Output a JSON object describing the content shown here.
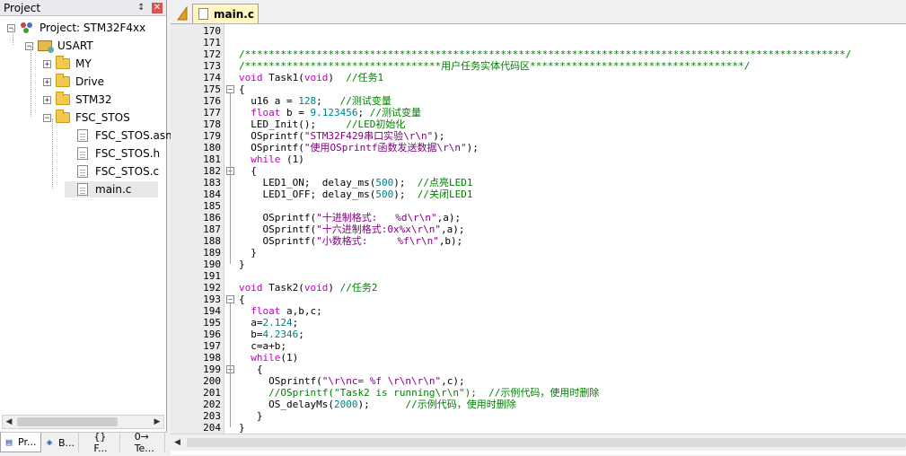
{
  "project_pane": {
    "title": "Project",
    "pin_icon": "pin-icon",
    "close_icon": "close-icon",
    "tree": [
      {
        "label": "Project: STM32F4xx",
        "depth": 0,
        "expander": "−",
        "icon": "project-icon"
      },
      {
        "label": "USART",
        "depth": 1,
        "expander": "−",
        "icon": "target-group-icon"
      },
      {
        "label": "MY",
        "depth": 2,
        "expander": "+",
        "icon": "folder-icon"
      },
      {
        "label": "Drive",
        "depth": 2,
        "expander": "+",
        "icon": "folder-icon"
      },
      {
        "label": "STM32",
        "depth": 2,
        "expander": "+",
        "icon": "folder-icon"
      },
      {
        "label": "FSC_STOS",
        "depth": 2,
        "expander": "−",
        "icon": "open-folder-icon"
      },
      {
        "label": "FSC_STOS.asm",
        "depth": 3,
        "expander": "",
        "icon": "file-icon"
      },
      {
        "label": "FSC_STOS.h",
        "depth": 3,
        "expander": "",
        "icon": "file-icon"
      },
      {
        "label": "FSC_STOS.c",
        "depth": 3,
        "expander": "",
        "icon": "file-icon"
      },
      {
        "label": "main.c",
        "depth": 3,
        "expander": "",
        "icon": "file-icon",
        "selected": true
      }
    ],
    "bottom_tabs": [
      {
        "label": "Pr...",
        "icon": "project-tab-icon",
        "active": true
      },
      {
        "label": "B...",
        "icon": "books-icon"
      },
      {
        "label": "{} F...",
        "icon": "functions-icon"
      },
      {
        "label": "0→ Te...",
        "icon": "templates-icon"
      }
    ]
  },
  "editor": {
    "active_tab": "main.c",
    "lines": [
      {
        "n": "170",
        "fold": "",
        "parts": []
      },
      {
        "n": "171",
        "fold": "",
        "parts": []
      },
      {
        "n": "172",
        "fold": "",
        "parts": [
          {
            "c": "cm",
            "t": "/*****************************************************************************************************/"
          }
        ]
      },
      {
        "n": "173",
        "fold": "",
        "parts": [
          {
            "c": "cm",
            "t": "/*********************************用户任务实体代码区************************************/"
          }
        ]
      },
      {
        "n": "174",
        "fold": "",
        "parts": [
          {
            "c": "kw",
            "t": "void"
          },
          {
            "c": "plain",
            "t": " Task1("
          },
          {
            "c": "kw",
            "t": "void"
          },
          {
            "c": "plain",
            "t": ")  "
          },
          {
            "c": "cm",
            "t": "//任务1"
          }
        ]
      },
      {
        "n": "175",
        "fold": "−",
        "parts": [
          {
            "c": "plain",
            "t": "{"
          }
        ]
      },
      {
        "n": "176",
        "fold": "",
        "parts": [
          {
            "c": "plain",
            "t": "  u16 a = "
          },
          {
            "c": "num",
            "t": "128"
          },
          {
            "c": "plain",
            "t": ";   "
          },
          {
            "c": "cm",
            "t": "//测试变量"
          }
        ]
      },
      {
        "n": "177",
        "fold": "",
        "parts": [
          {
            "c": "plain",
            "t": "  "
          },
          {
            "c": "kw",
            "t": "float"
          },
          {
            "c": "plain",
            "t": " b = "
          },
          {
            "c": "num",
            "t": "9.123456"
          },
          {
            "c": "plain",
            "t": "; "
          },
          {
            "c": "cm",
            "t": "//测试变量"
          }
        ]
      },
      {
        "n": "178",
        "fold": "",
        "parts": [
          {
            "c": "plain",
            "t": "  LED_Init();     "
          },
          {
            "c": "cm",
            "t": "//LED初始化"
          }
        ]
      },
      {
        "n": "179",
        "fold": "",
        "parts": [
          {
            "c": "plain",
            "t": "  OSprintf("
          },
          {
            "c": "str",
            "t": "\"STM32F429串口实验\\r\\n\""
          },
          {
            "c": "plain",
            "t": ");"
          }
        ]
      },
      {
        "n": "180",
        "fold": "",
        "parts": [
          {
            "c": "plain",
            "t": "  OSprintf("
          },
          {
            "c": "str",
            "t": "\"使用OSprintf函数发送数据\\r\\n\""
          },
          {
            "c": "plain",
            "t": ");"
          }
        ]
      },
      {
        "n": "181",
        "fold": "",
        "parts": [
          {
            "c": "plain",
            "t": "  "
          },
          {
            "c": "kw",
            "t": "while"
          },
          {
            "c": "plain",
            "t": " (1)"
          }
        ]
      },
      {
        "n": "182",
        "fold": "−",
        "parts": [
          {
            "c": "plain",
            "t": "  {"
          }
        ]
      },
      {
        "n": "183",
        "fold": "",
        "parts": [
          {
            "c": "plain",
            "t": "    LED1_ON;  delay_ms("
          },
          {
            "c": "num",
            "t": "500"
          },
          {
            "c": "plain",
            "t": ");  "
          },
          {
            "c": "cm",
            "t": "//点亮LED1"
          }
        ]
      },
      {
        "n": "184",
        "fold": "",
        "parts": [
          {
            "c": "plain",
            "t": "    LED1_OFF; delay_ms("
          },
          {
            "c": "num",
            "t": "500"
          },
          {
            "c": "plain",
            "t": ");  "
          },
          {
            "c": "cm",
            "t": "//关闭LED1"
          }
        ]
      },
      {
        "n": "185",
        "fold": "",
        "parts": []
      },
      {
        "n": "186",
        "fold": "",
        "parts": [
          {
            "c": "plain",
            "t": "    OSprintf("
          },
          {
            "c": "str",
            "t": "\"十进制格式:   %d\\r\\n\""
          },
          {
            "c": "plain",
            "t": ",a);"
          }
        ]
      },
      {
        "n": "187",
        "fold": "",
        "parts": [
          {
            "c": "plain",
            "t": "    OSprintf("
          },
          {
            "c": "str",
            "t": "\"十六进制格式:0x%x\\r\\n\""
          },
          {
            "c": "plain",
            "t": ",a);"
          }
        ]
      },
      {
        "n": "188",
        "fold": "",
        "parts": [
          {
            "c": "plain",
            "t": "    OSprintf("
          },
          {
            "c": "str",
            "t": "\"小数格式:     %f\\r\\n\""
          },
          {
            "c": "plain",
            "t": ",b);"
          }
        ]
      },
      {
        "n": "189",
        "fold": "",
        "parts": [
          {
            "c": "plain",
            "t": "  }"
          }
        ]
      },
      {
        "n": "190",
        "fold": "",
        "parts": [
          {
            "c": "plain",
            "t": "}"
          }
        ]
      },
      {
        "n": "191",
        "fold": "",
        "parts": []
      },
      {
        "n": "192",
        "fold": "",
        "parts": [
          {
            "c": "kw",
            "t": "void"
          },
          {
            "c": "plain",
            "t": " Task2("
          },
          {
            "c": "kw",
            "t": "void"
          },
          {
            "c": "plain",
            "t": ") "
          },
          {
            "c": "cm",
            "t": "//任务2"
          }
        ]
      },
      {
        "n": "193",
        "fold": "−",
        "parts": [
          {
            "c": "plain",
            "t": "{"
          }
        ]
      },
      {
        "n": "194",
        "fold": "",
        "parts": [
          {
            "c": "plain",
            "t": "  "
          },
          {
            "c": "kw",
            "t": "float"
          },
          {
            "c": "plain",
            "t": " a,b,c;"
          }
        ]
      },
      {
        "n": "195",
        "fold": "",
        "parts": [
          {
            "c": "plain",
            "t": "  a="
          },
          {
            "c": "num",
            "t": "2.124"
          },
          {
            "c": "plain",
            "t": ";"
          }
        ]
      },
      {
        "n": "196",
        "fold": "",
        "parts": [
          {
            "c": "plain",
            "t": "  b="
          },
          {
            "c": "num",
            "t": "4.2346"
          },
          {
            "c": "plain",
            "t": ";"
          }
        ]
      },
      {
        "n": "197",
        "fold": "",
        "parts": [
          {
            "c": "plain",
            "t": "  c=a+b;"
          }
        ]
      },
      {
        "n": "198",
        "fold": "",
        "parts": [
          {
            "c": "plain",
            "t": "  "
          },
          {
            "c": "kw",
            "t": "while"
          },
          {
            "c": "plain",
            "t": "(1)"
          }
        ]
      },
      {
        "n": "199",
        "fold": "−",
        "parts": [
          {
            "c": "plain",
            "t": "   {"
          }
        ]
      },
      {
        "n": "200",
        "fold": "",
        "parts": [
          {
            "c": "plain",
            "t": "     OSprintf("
          },
          {
            "c": "str",
            "t": "\"\\r\\nc= %f \\r\\n\\r\\n\""
          },
          {
            "c": "plain",
            "t": ",c);"
          }
        ]
      },
      {
        "n": "201",
        "fold": "",
        "parts": [
          {
            "c": "plain",
            "t": "     "
          },
          {
            "c": "cm",
            "t": "//OSprintf(\"Task2 is running\\r\\n\");  //示例代码，使用时删除"
          }
        ]
      },
      {
        "n": "202",
        "fold": "",
        "parts": [
          {
            "c": "plain",
            "t": "     OS_delayMs("
          },
          {
            "c": "num",
            "t": "2000"
          },
          {
            "c": "plain",
            "t": ");      "
          },
          {
            "c": "cm",
            "t": "//示例代码，使用时删除"
          }
        ]
      },
      {
        "n": "203",
        "fold": "",
        "parts": [
          {
            "c": "plain",
            "t": "   }"
          }
        ]
      },
      {
        "n": "204",
        "fold": "",
        "parts": [
          {
            "c": "plain",
            "t": "}"
          }
        ]
      }
    ]
  },
  "colors": {
    "keyword": "#c000c0",
    "number": "#008080",
    "string": "#800080",
    "comment": "#008000",
    "tab_active": "#fff6c2"
  }
}
